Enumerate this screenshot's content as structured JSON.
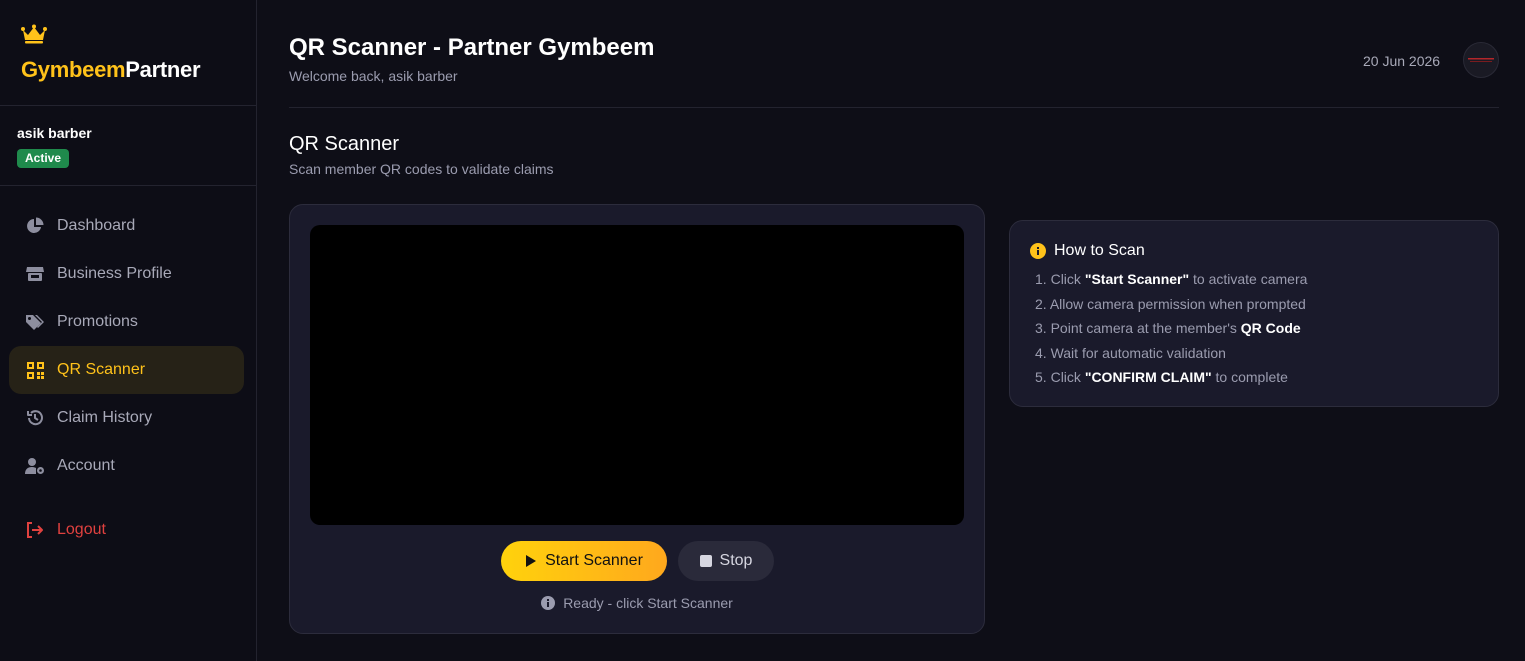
{
  "brand": {
    "part1": "Gymbeem",
    "part2": "Partner",
    "icon": "crown-icon",
    "accent": "#ffc21a"
  },
  "user": {
    "name": "asik barber",
    "status": "Active",
    "status_color": "#1f8a4c"
  },
  "nav": [
    {
      "label": "Dashboard",
      "icon": "pie-chart-icon"
    },
    {
      "label": "Business Profile",
      "icon": "store-icon"
    },
    {
      "label": "Promotions",
      "icon": "tags-icon"
    },
    {
      "label": "QR Scanner",
      "icon": "qr-code-icon",
      "active": true
    },
    {
      "label": "Claim History",
      "icon": "history-icon"
    },
    {
      "label": "Account",
      "icon": "user-gear-icon"
    }
  ],
  "logout": {
    "label": "Logout",
    "icon": "logout-icon",
    "color": "#e0413f"
  },
  "header": {
    "title": "QR Scanner - Partner Gymbeem",
    "subtitle": "Welcome back, asik barber",
    "date": "20 Jun 2026"
  },
  "section": {
    "title": "QR Scanner",
    "subtitle": "Scan member QR codes to validate claims"
  },
  "scanner": {
    "start_label": "Start Scanner",
    "stop_label": "Stop",
    "status": "Ready - click Start Scanner"
  },
  "howto": {
    "title": "How to Scan",
    "steps": [
      {
        "num": "1.",
        "pre": "Click ",
        "bold": "\"Start Scanner\"",
        "post": " to activate camera"
      },
      {
        "num": "2.",
        "pre": "Allow camera permission when prompted",
        "bold": "",
        "post": ""
      },
      {
        "num": "3.",
        "pre": "Point camera at the member's ",
        "bold": "QR Code",
        "post": ""
      },
      {
        "num": "4.",
        "pre": "Wait for automatic validation",
        "bold": "",
        "post": ""
      },
      {
        "num": "5.",
        "pre": "Click ",
        "bold": "\"CONFIRM CLAIM\"",
        "post": " to complete"
      }
    ]
  }
}
